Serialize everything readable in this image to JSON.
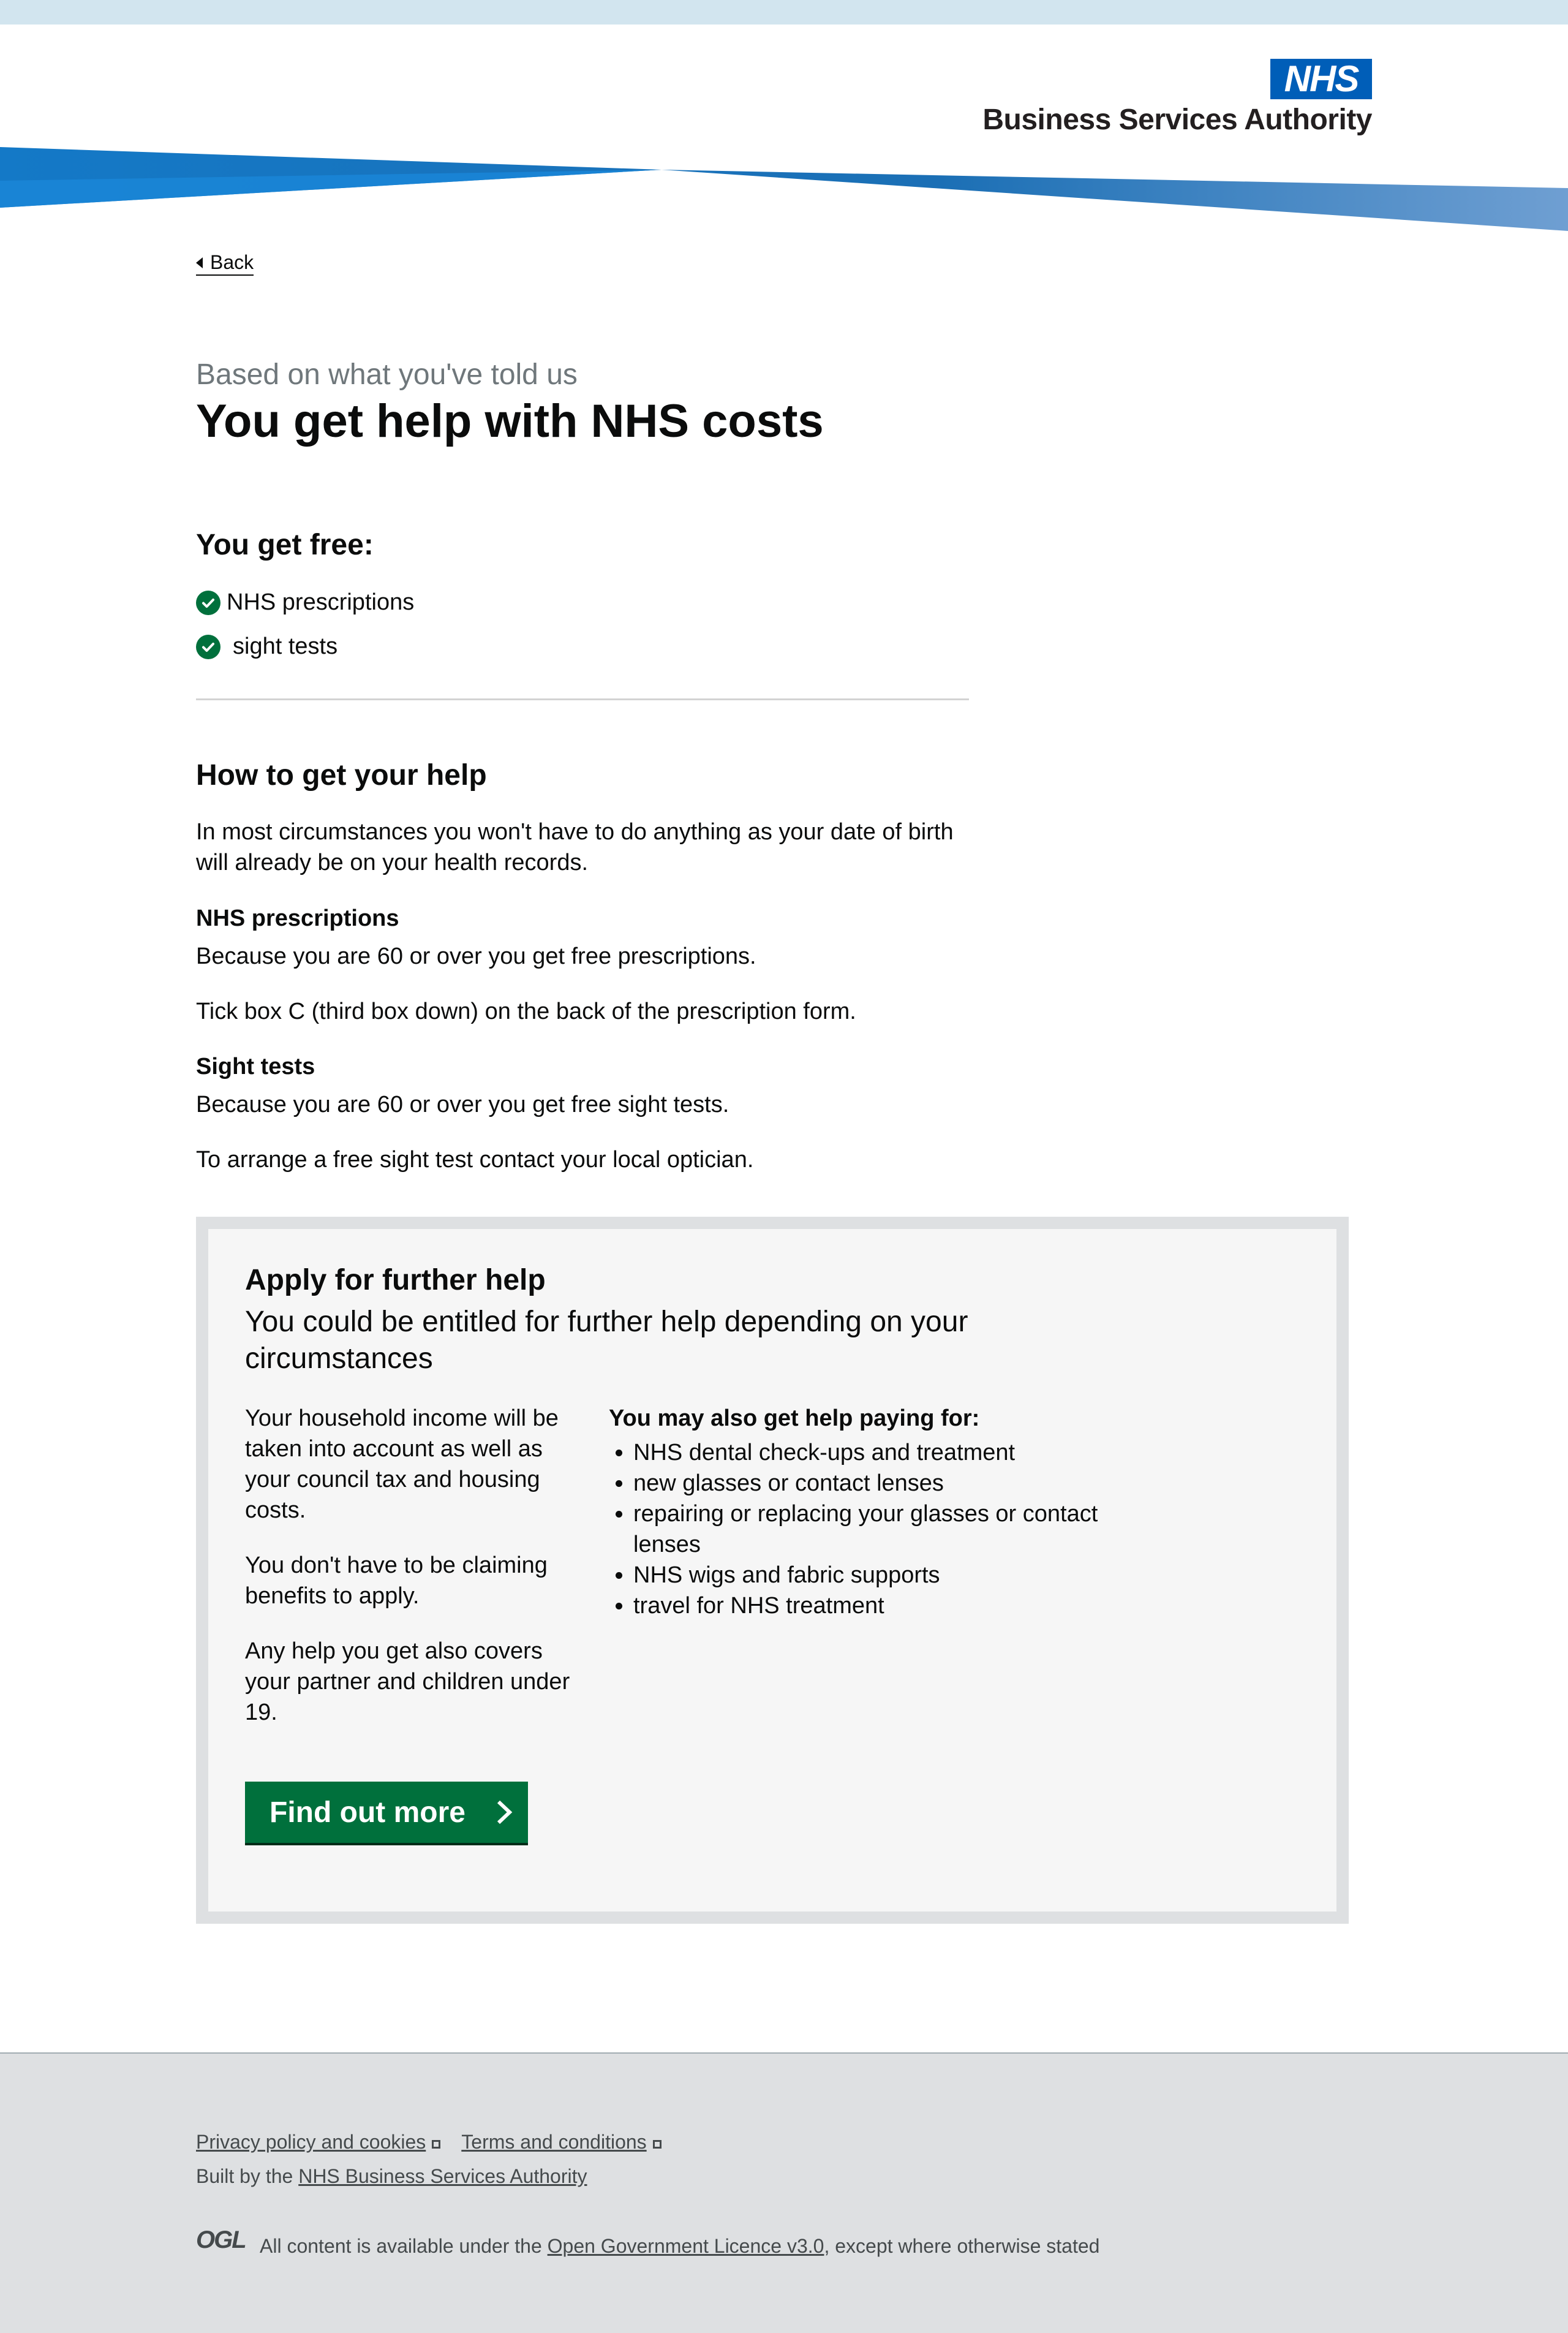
{
  "header": {
    "logo_badge": "NHS",
    "logo_text": "Business Services Authority",
    "colors": {
      "badge": "#005eb8",
      "swoosh_dark": "#1479c7",
      "swoosh_light": "#5b9bd5",
      "top_strip": "#d2e5ef"
    }
  },
  "nav": {
    "back_label": "Back",
    "back_icon": "caret-left-icon"
  },
  "result": {
    "caption": "Based on what you've told us",
    "title": "You get help with NHS costs",
    "free_heading": "You get free:",
    "free_items": [
      "NHS prescriptions",
      "sight tests"
    ],
    "free_icon": "check-circle-icon",
    "accent_color": "#00703c"
  },
  "how": {
    "heading": "How to get your help",
    "intro": "In most circumstances you won't have to do anything as your date of birth will already be on your health records.",
    "sections": [
      {
        "heading": "NHS prescriptions",
        "lines": [
          "Because you are 60 or over you get free prescriptions.",
          "Tick box C (third box down) on the back of the prescription form."
        ]
      },
      {
        "heading": "Sight tests",
        "lines": [
          "Because you are 60 or over you get free sight tests.",
          "To arrange a free sight test contact your local optician."
        ]
      }
    ]
  },
  "further": {
    "heading": "Apply for further help",
    "lede": "You could be entitled for further help depending on your circumstances",
    "left_paragraphs": [
      "Your household income will be taken into account as well as your council tax and housing costs.",
      "You don't have to be claiming benefits to apply.",
      "Any help you get also covers your partner and children under 19."
    ],
    "right_heading": "You may also get help paying for:",
    "right_items": [
      "NHS dental check-ups and treatment",
      "new glasses or contact lenses",
      "repairing or replacing your glasses or contact lenses",
      "NHS wigs and fabric supports",
      "travel for NHS treatment"
    ],
    "button_label": "Find out more",
    "button_icon": "chevron-right-icon"
  },
  "footer": {
    "links": [
      "Privacy policy and cookies",
      "Terms and conditions"
    ],
    "external_icon": "external-link-icon",
    "built_prefix": "Built by the",
    "built_link": "NHS Business Services Authority",
    "ogl_logo": "OGL",
    "licence_prefix": "All content is available under the",
    "licence_link": "Open Government Licence v3.0",
    "licence_suffix": ", except where otherwise stated"
  }
}
